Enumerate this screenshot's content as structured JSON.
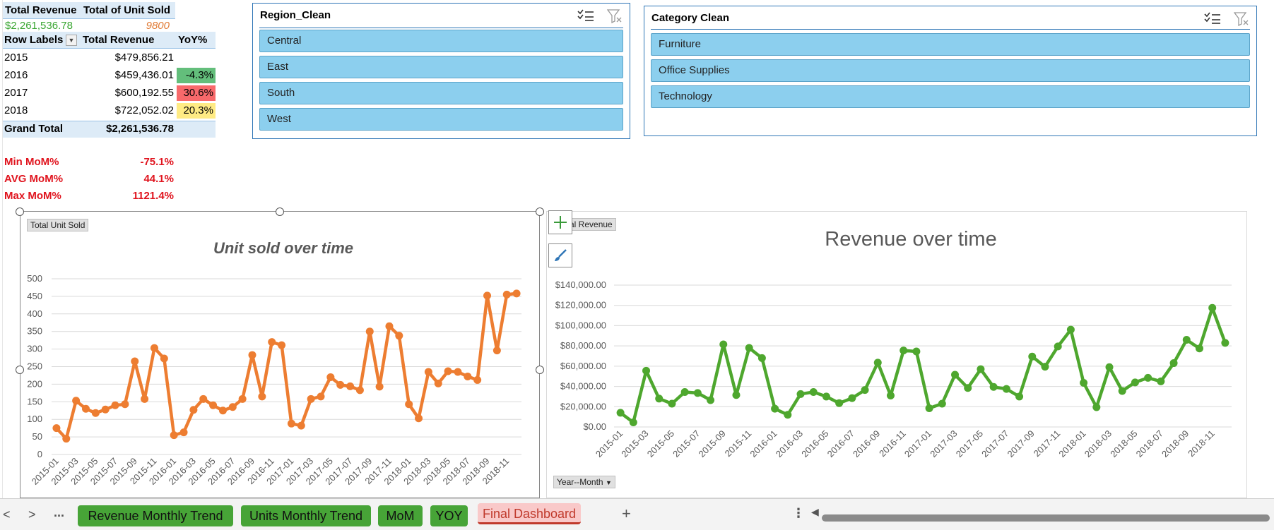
{
  "summary": {
    "total_revenue_label": "Total Revenue",
    "total_units_label": "Total of Unit Sold",
    "total_revenue_value": "$2,261,536.78",
    "total_units_value": "9800",
    "pivot_headers": [
      "Row Labels",
      "Total Revenue",
      "YoY%"
    ],
    "rows": [
      {
        "year": "2015",
        "revenue": "$479,856.21",
        "yoy": ""
      },
      {
        "year": "2016",
        "revenue": "$459,436.01",
        "yoy": "-4.3%"
      },
      {
        "year": "2017",
        "revenue": "$600,192.55",
        "yoy": "30.6%"
      },
      {
        "year": "2018",
        "revenue": "$722,052.02",
        "yoy": "20.3%"
      }
    ],
    "grand_total_label": "Grand Total",
    "grand_total_value": "$2,261,536.78",
    "mom": [
      {
        "label": "Min MoM%",
        "value": "-75.1%"
      },
      {
        "label": "AVG MoM%",
        "value": "44.1%"
      },
      {
        "label": "Max MoM%",
        "value": "1121.4%"
      }
    ]
  },
  "slicers": {
    "region": {
      "title": "Region_Clean",
      "items": [
        "Central",
        "East",
        "South",
        "West"
      ]
    },
    "category": {
      "title": "Category Clean",
      "items": [
        "Furniture",
        "Office Supplies",
        "Technology"
      ]
    }
  },
  "colors": {
    "units_line": "#ed7d31",
    "revenue_line": "#4ea72e",
    "slicer_item": "#8ccfee",
    "tab_green": "#47a437"
  },
  "chart_data": [
    {
      "type": "line",
      "title": "Unit sold over time",
      "field_button": "Total Unit Sold",
      "ylim": [
        0,
        500
      ],
      "yticks": [
        "0",
        "50",
        "100",
        "150",
        "200",
        "250",
        "300",
        "350",
        "400",
        "450",
        "500"
      ],
      "x": [
        "2015-01",
        "2015-02",
        "2015-03",
        "2015-04",
        "2015-05",
        "2015-06",
        "2015-07",
        "2015-08",
        "2015-09",
        "2015-10",
        "2015-11",
        "2015-12",
        "2016-01",
        "2016-02",
        "2016-03",
        "2016-04",
        "2016-05",
        "2016-06",
        "2016-07",
        "2016-08",
        "2016-09",
        "2016-10",
        "2016-11",
        "2016-12",
        "2017-01",
        "2017-02",
        "2017-03",
        "2017-04",
        "2017-05",
        "2017-06",
        "2017-07",
        "2017-08",
        "2017-09",
        "2017-10",
        "2017-11",
        "2017-12",
        "2018-01",
        "2018-02",
        "2018-03",
        "2018-04",
        "2018-05",
        "2018-06",
        "2018-07",
        "2018-08",
        "2018-09",
        "2018-10",
        "2018-11",
        "2018-12"
      ],
      "xtick_labels": [
        "2015-01",
        "2015-03",
        "2015-05",
        "2015-07",
        "2015-09",
        "2015-11",
        "2016-01",
        "2016-03",
        "2016-05",
        "2016-07",
        "2016-09",
        "2016-11",
        "2017-01",
        "2017-03",
        "2017-05",
        "2017-07",
        "2017-09",
        "2017-11",
        "2018-01",
        "2018-03",
        "2018-05",
        "2018-07",
        "2018-09",
        "2018-11"
      ],
      "values": [
        75,
        45,
        153,
        130,
        118,
        128,
        140,
        143,
        265,
        158,
        303,
        273,
        55,
        63,
        127,
        158,
        140,
        125,
        135,
        158,
        283,
        165,
        320,
        311,
        88,
        82,
        158,
        165,
        220,
        198,
        194,
        183,
        350,
        193,
        365,
        338,
        143,
        103,
        235,
        202,
        237,
        235,
        222,
        212,
        452,
        296,
        455,
        458
      ],
      "grid": true
    },
    {
      "type": "line",
      "title": "Revenue over time",
      "field_button": "Total Revenue",
      "axis_field_button": "Year--Month",
      "ylim": [
        0,
        140000
      ],
      "yticks": [
        "$0.00",
        "$20,000.00",
        "$40,000.00",
        "$60,000.00",
        "$80,000.00",
        "$100,000.00",
        "$120,000.00",
        "$140,000.00"
      ],
      "x": [
        "2015-01",
        "2015-02",
        "2015-03",
        "2015-04",
        "2015-05",
        "2015-06",
        "2015-07",
        "2015-08",
        "2015-09",
        "2015-10",
        "2015-11",
        "2015-12",
        "2016-01",
        "2016-02",
        "2016-03",
        "2016-04",
        "2016-05",
        "2016-06",
        "2016-07",
        "2016-08",
        "2016-09",
        "2016-10",
        "2016-11",
        "2016-12",
        "2017-01",
        "2017-02",
        "2017-03",
        "2017-04",
        "2017-05",
        "2017-06",
        "2017-07",
        "2017-08",
        "2017-09",
        "2017-10",
        "2017-11",
        "2017-12",
        "2018-01",
        "2018-02",
        "2018-03",
        "2018-04",
        "2018-05",
        "2018-06",
        "2018-07",
        "2018-08",
        "2018-09",
        "2018-10",
        "2018-11",
        "2018-12"
      ],
      "xtick_labels": [
        "2015-01",
        "2015-03",
        "2015-05",
        "2015-07",
        "2015-09",
        "2015-11",
        "2016-01",
        "2016-03",
        "2016-05",
        "2016-07",
        "2016-09",
        "2016-11",
        "2017-01",
        "2017-03",
        "2017-05",
        "2017-07",
        "2017-09",
        "2017-11",
        "2018-01",
        "2018-03",
        "2018-05",
        "2018-07",
        "2018-09",
        "2018-11"
      ],
      "values": [
        14000,
        4500,
        55500,
        28000,
        23000,
        34500,
        33500,
        26500,
        81500,
        31500,
        78000,
        68000,
        18000,
        12000,
        32500,
        34500,
        30000,
        23500,
        28500,
        36500,
        63500,
        31000,
        75500,
        74500,
        18500,
        23000,
        51500,
        38500,
        57000,
        39500,
        37500,
        30000,
        69500,
        59500,
        79500,
        96000,
        43500,
        19500,
        59000,
        35500,
        44000,
        48500,
        45000,
        63000,
        86000,
        77500,
        117500,
        83000
      ],
      "grid": true
    }
  ],
  "tabs": [
    "Revenue Monthly Trend",
    "Units Monthly Trend",
    "MoM",
    "YOY",
    "Final Dashboard"
  ],
  "tabbar": {
    "prev": "<",
    "next": ">",
    "more": "...",
    "add": "+",
    "menu": "⋮"
  }
}
